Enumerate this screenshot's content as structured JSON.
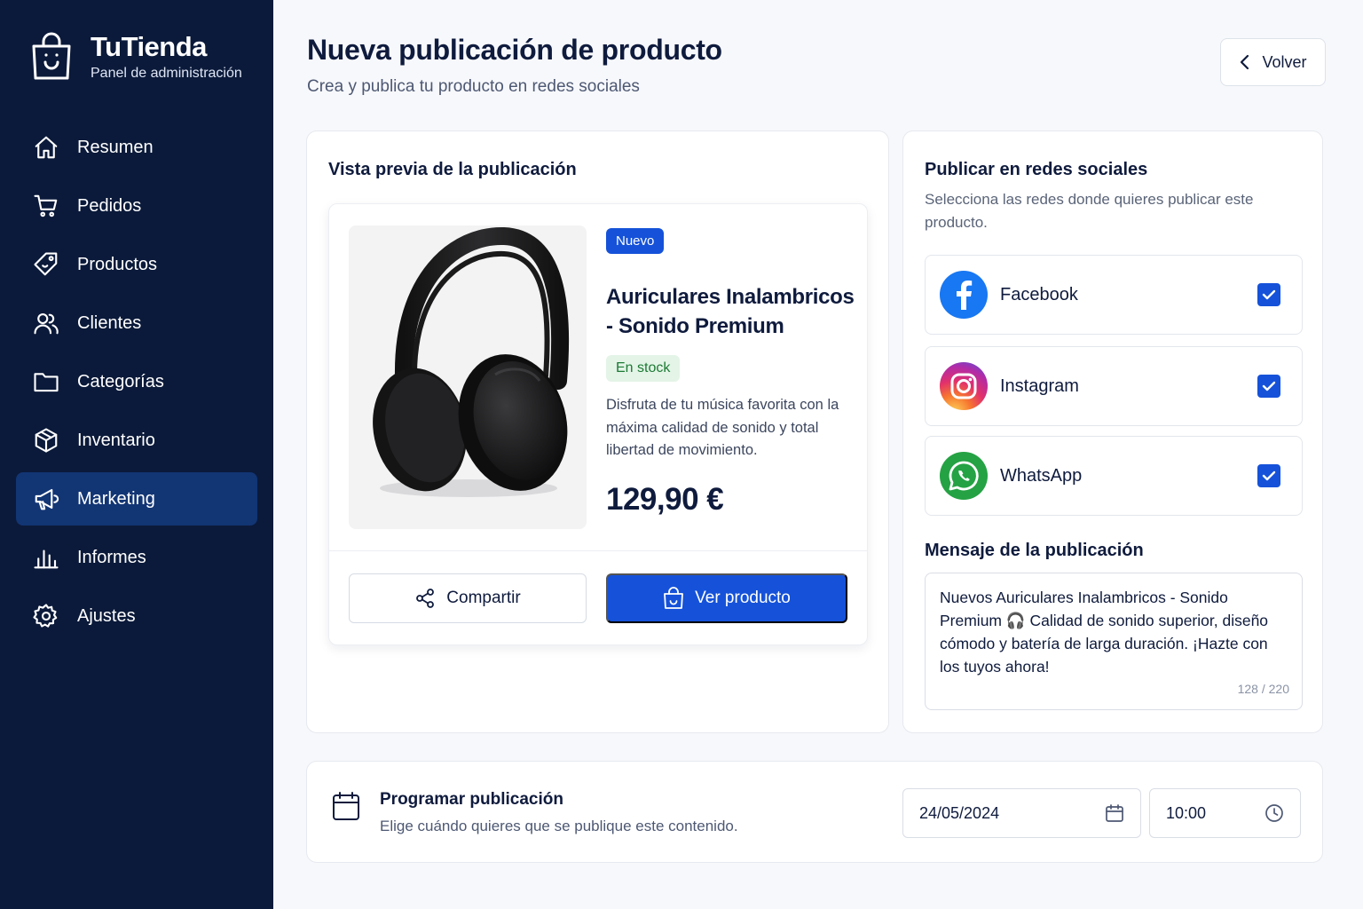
{
  "brand": {
    "name": "TuTienda",
    "subtitle": "Panel de administración"
  },
  "sidebar": {
    "items": [
      {
        "label": "Resumen",
        "icon": "home-icon"
      },
      {
        "label": "Pedidos",
        "icon": "cart-icon"
      },
      {
        "label": "Productos",
        "icon": "tag-icon"
      },
      {
        "label": "Clientes",
        "icon": "users-icon"
      },
      {
        "label": "Categorías",
        "icon": "folder-icon"
      },
      {
        "label": "Inventario",
        "icon": "box-icon"
      },
      {
        "label": "Marketing",
        "icon": "megaphone-icon",
        "active": true
      },
      {
        "label": "Informes",
        "icon": "bar-chart-icon"
      },
      {
        "label": "Ajustes",
        "icon": "gear-icon"
      }
    ]
  },
  "header": {
    "title": "Nueva publicación de producto",
    "subtitle": "Crea y publica tu producto en redes sociales",
    "back_label": "Volver"
  },
  "preview": {
    "title": "Vista previa de la publicación",
    "badge": "Nuevo",
    "product_name": "Auriculares Inalambricos - Sonido Premium",
    "stock": "En stock",
    "description": "Disfruta de tu música favorita con la máxima calidad de sonido y total libertad de movimiento.",
    "price": "129,90 €",
    "share_label": "Compartir",
    "view_label": "Ver producto"
  },
  "social": {
    "title": "Publicar en redes sociales",
    "subtitle": "Selecciona las redes donde quieres publicar este producto.",
    "networks": [
      {
        "label": "Facebook",
        "icon": "facebook-icon",
        "checked": true
      },
      {
        "label": "Instagram",
        "icon": "instagram-icon",
        "checked": true
      },
      {
        "label": "WhatsApp",
        "icon": "whatsapp-icon",
        "checked": true
      }
    ],
    "message_title": "Mensaje de la publicación",
    "message": "Nuevos Auriculares Inalambricos - Sonido Premium 🎧 Calidad de sonido superior, diseño cómodo y batería de larga duración. ¡Hazte con los tuyos ahora!",
    "message_count": "128 / 220"
  },
  "schedule": {
    "title": "Programar publicación",
    "subtitle": "Elige cuándo quieres que se publique este contenido.",
    "date": "24/05/2024",
    "time": "10:00"
  },
  "colors": {
    "sidebar_bg": "#0b1a3a",
    "active_nav": "#123574",
    "primary": "#1552d9",
    "stock_bg": "#e4f4e7",
    "stock_text": "#1c7a34",
    "facebook": "#1877f2",
    "whatsapp": "#25a244"
  }
}
